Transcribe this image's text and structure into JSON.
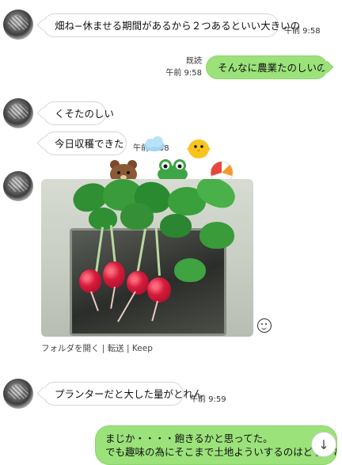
{
  "messages": [
    {
      "text": "畑ね−休ませる期間があるから２つあるといい大きいの",
      "time": "午前 9:58"
    },
    {
      "read": "既読",
      "time": "午前 9:58",
      "text": "そんなに農業たのしいの？"
    },
    {
      "text": "くそたのしい"
    },
    {
      "text": "今日収穫できた",
      "time": "午前 9:58"
    },
    {
      "photo_links": "フォルダを開く | 転送 | Keep"
    },
    {
      "text": "プランターだと大した量がとれん",
      "time": "午前 9:59"
    },
    {
      "line1": "まじか・・・・飽きるかと思ってた。",
      "line2": "でも趣味の為にそこまで土地よういするのはどうかと。"
    }
  ],
  "stamps": [
    "brown-bear",
    "frog",
    "chick",
    "beach-ball"
  ],
  "colors": {
    "my_bubble": "#9be27a",
    "their_bubble": "#ffffff"
  }
}
